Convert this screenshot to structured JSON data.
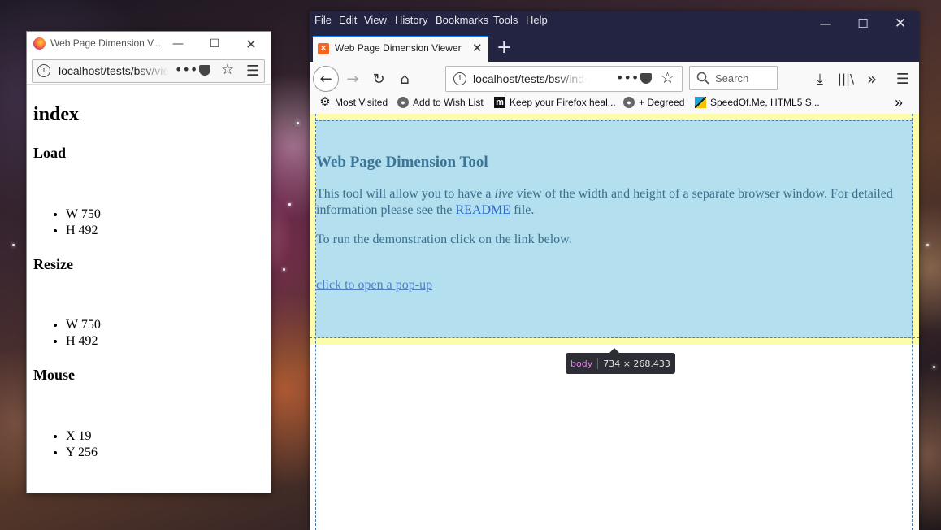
{
  "popup": {
    "title": "Web Page Dimension V...",
    "url": "localhost/tests/bsv/view",
    "heading": "index",
    "sections": [
      {
        "title": "Load",
        "items": [
          "W 750",
          "H 492"
        ]
      },
      {
        "title": "Resize",
        "items": [
          "W 750",
          "H 492"
        ]
      },
      {
        "title": "Mouse",
        "items": [
          "X 19",
          "Y 256"
        ]
      }
    ]
  },
  "main": {
    "menu": [
      "File",
      "Edit",
      "View",
      "History",
      "Bookmarks",
      "Tools",
      "Help"
    ],
    "tab_title": "Web Page Dimension Viewer",
    "url": "localhost/tests/bsv/index",
    "search_placeholder": "Search",
    "bookmarks": [
      "Most Visited",
      "Add to Wish List",
      "Keep your Firefox heal...",
      "+ Degreed",
      "SpeedOf.Me, HTML5 S..."
    ],
    "page": {
      "heading": "Web Page Dimension Tool",
      "p1_before": "This tool will allow you to have a ",
      "p1_em": "live",
      "p1_mid": " view of the width and height of a separate browser window. For detailed information please see the ",
      "p1_link": "README",
      "p1_after": " file.",
      "p2": "To run the demonstration click on the link below.",
      "link": "click to open a pop-up"
    },
    "inspector": {
      "tag": "body",
      "size": "734 × 268.433"
    }
  },
  "colors": {
    "menubar": "#232442",
    "page_highlight": "#b3dfef",
    "margin_highlight": "#fcfcaa",
    "accent": "#0a84ff"
  }
}
